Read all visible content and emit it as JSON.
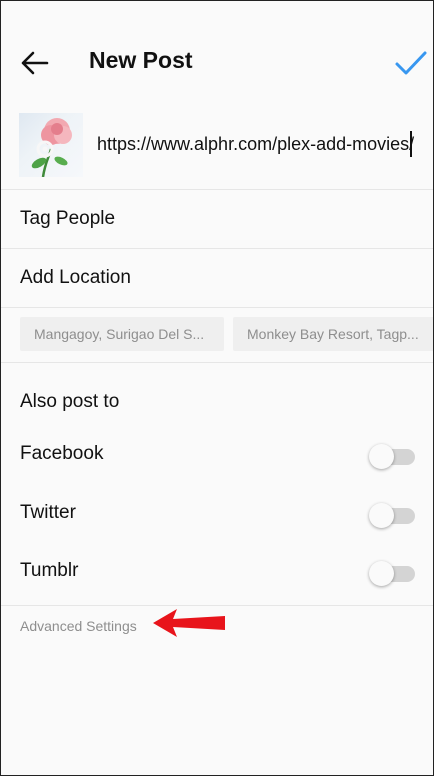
{
  "header": {
    "title": "New Post",
    "back_icon": "arrow-left-icon",
    "confirm_icon": "checkmark-icon",
    "accent_color": "#3897f0"
  },
  "caption": {
    "value": "https://www.alphr.com/plex-add-movies/",
    "thumbnail": "rose-photo-thumbnail"
  },
  "options": {
    "tag_people": "Tag People",
    "add_location": "Add Location"
  },
  "location_suggestions": [
    "Mangagoy, Surigao Del S...",
    "Monkey Bay Resort, Tagp..."
  ],
  "share": {
    "title": "Also post to",
    "items": [
      {
        "label": "Facebook",
        "enabled": false
      },
      {
        "label": "Twitter",
        "enabled": false
      },
      {
        "label": "Tumblr",
        "enabled": false
      }
    ]
  },
  "advanced": {
    "label": "Advanced Settings",
    "annotation_color": "#e8141b"
  }
}
